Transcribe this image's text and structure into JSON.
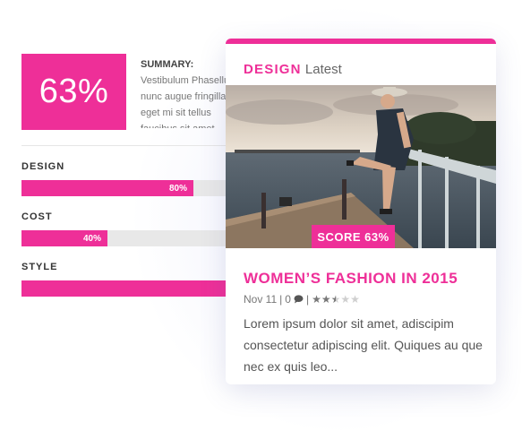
{
  "review": {
    "score": "63%",
    "summary_label": "SUMMARY:",
    "summary_text": "Vestibulum Phasellus nunc augue fringilla eget mi sit tellus faucibus sit amet",
    "bars": [
      {
        "label": "DESIGN",
        "value_text": "80%",
        "value": 0.8
      },
      {
        "label": "COST",
        "value_text": "40%",
        "value": 0.4
      },
      {
        "label": "STYLE",
        "value_text": "",
        "value": 1.0
      }
    ]
  },
  "card": {
    "category": "DESIGN",
    "category_sub": "Latest",
    "score_badge": "SCORE 63%",
    "title": "WOMEN’S FASHION IN 2015",
    "date": "Nov 11",
    "comments": "0",
    "rating_filled": 2.5,
    "rating_max": 5,
    "excerpt": "Lorem ipsum dolor sit amet, adiscipim consectetur adipiscing elit. Quiques au que nec ex quis leo..."
  },
  "colors": {
    "accent": "#ee2f98",
    "track": "#e8e8e8",
    "text": "#555555"
  }
}
